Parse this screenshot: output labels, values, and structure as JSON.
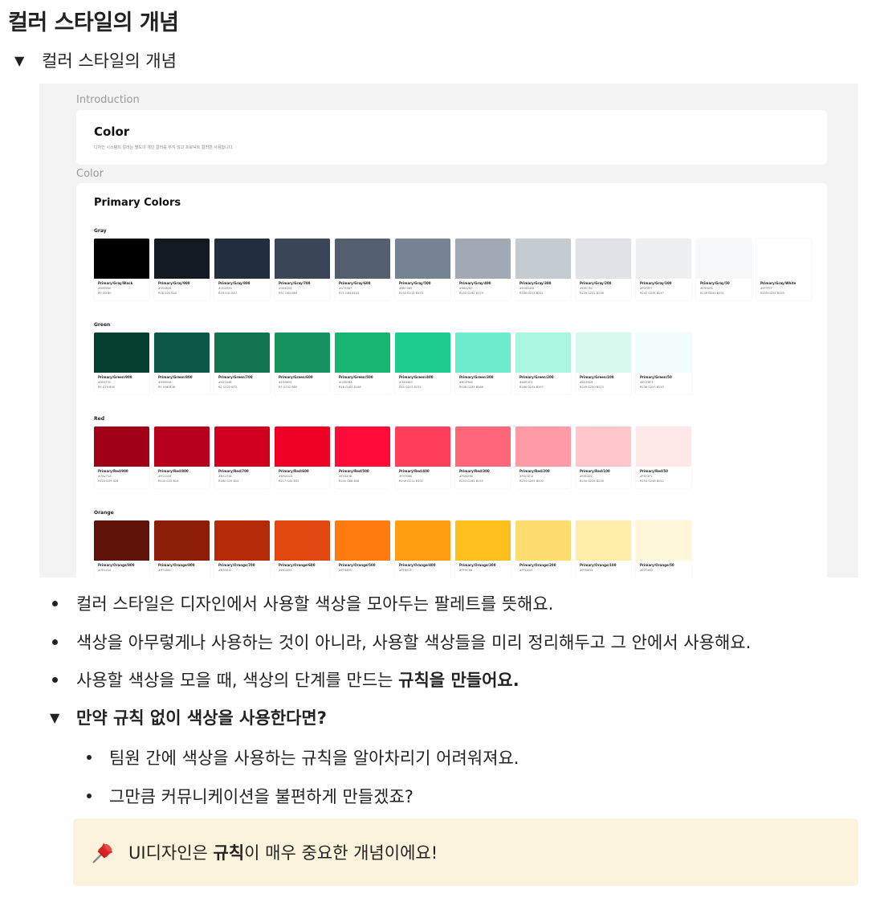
{
  "page_title": "컬러 스타일의 개념",
  "toggle": {
    "title": "컬러 스타일의 개념"
  },
  "image": {
    "intro_label": "Introduction",
    "intro_card": {
      "title": "Color",
      "desc": "디자인 시스템의 컬러는 별도의 개인 컬러를 두지 않고 프로덕트 컬러만 사용합니다."
    },
    "color_label": "Color",
    "primary_title": "Primary Colors",
    "groups": [
      {
        "label": "Gray",
        "swatches": [
          {
            "name": "Primary/Gray/Black",
            "hex": "#000000",
            "rgb": "R0 G0 B0",
            "color": "#000000"
          },
          {
            "name": "Primary/Gray/900",
            "hex": "#101828",
            "rgb": "R16 G24 B40",
            "color": "#131a22"
          },
          {
            "name": "Primary/Gray/800",
            "hex": "#1D2939",
            "rgb": "R29 G41 B57",
            "color": "#222e3e"
          },
          {
            "name": "Primary/Gray/700",
            "hex": "#344054",
            "rgb": "R52 G64 B84",
            "color": "#3a4556"
          },
          {
            "name": "Primary/Gray/600",
            "hex": "#475467",
            "rgb": "R71 G84 B103",
            "color": "#545f6d"
          },
          {
            "name": "Primary/Gray/500",
            "hex": "#667085",
            "rgb": "R102 G112 B133",
            "color": "#758392"
          },
          {
            "name": "Primary/Gray/400",
            "hex": "#98A2B3",
            "rgb": "R152 G162 B179",
            "color": "#a0a9b4"
          },
          {
            "name": "Primary/Gray/300",
            "hex": "#D0D5DD",
            "rgb": "R208 G213 B221",
            "color": "#c5ccd1"
          },
          {
            "name": "Primary/Gray/200",
            "hex": "#E4E7EC",
            "rgb": "R228 G231 B236",
            "color": "#dfe2e6"
          },
          {
            "name": "Primary/Gray/100",
            "hex": "#F2F4F7",
            "rgb": "R242 G244 B247",
            "color": "#eceef0"
          },
          {
            "name": "Primary/Gray/50",
            "hex": "#F9FAFB",
            "rgb": "R249 G250 B251",
            "color": "#f7f8fa"
          },
          {
            "name": "Primary/Gray/White",
            "hex": "#FFFFFF",
            "rgb": "R255 G255 B255",
            "color": "#ffffff"
          }
        ]
      },
      {
        "label": "Green",
        "swatches": [
          {
            "name": "Primary/Green/900",
            "hex": "#054F31",
            "rgb": "R5 G79 B49",
            "color": "#053f2f"
          },
          {
            "name": "Primary/Green/800",
            "hex": "#05603A",
            "rgb": "R5 G96 B58",
            "color": "#0c5746"
          },
          {
            "name": "Primary/Green/700",
            "hex": "#027A48",
            "rgb": "R2 G122 B72",
            "color": "#127350"
          },
          {
            "name": "Primary/Green/600",
            "hex": "#039855",
            "rgb": "R3 G152 B85",
            "color": "#169260"
          },
          {
            "name": "Primary/Green/500",
            "hex": "#12B76A",
            "rgb": "R18 G183 B106",
            "color": "#17b46f"
          },
          {
            "name": "Primary/Green/400",
            "hex": "#32D583",
            "rgb": "R50 G213 B131",
            "color": "#1dcc8c"
          },
          {
            "name": "Primary/Green/300",
            "hex": "#6CE9A6",
            "rgb": "R108 G233 B166",
            "color": "#6deccb"
          },
          {
            "name": "Primary/Green/200",
            "hex": "#A6F4C5",
            "rgb": "R166 G244 B197",
            "color": "#a9f5dd"
          },
          {
            "name": "Primary/Green/100",
            "hex": "#D1FADF",
            "rgb": "R209 G250 B223",
            "color": "#d6faed"
          },
          {
            "name": "Primary/Green/50",
            "hex": "#ECFDF3",
            "rgb": "R236 G253 B243",
            "color": "#f0fdfa"
          }
        ]
      },
      {
        "label": "Red",
        "swatches": [
          {
            "name": "Primary/Red/900",
            "hex": "#7A271A",
            "rgb": "R122 G39 B26",
            "color": "#a10018"
          },
          {
            "name": "Primary/Red/800",
            "hex": "#912018",
            "rgb": "R145 G32 B24",
            "color": "#b8001d"
          },
          {
            "name": "Primary/Red/700",
            "hex": "#B42318",
            "rgb": "R180 G35 B24",
            "color": "#d10020"
          },
          {
            "name": "Primary/Red/600",
            "hex": "#D92D20",
            "rgb": "R217 G45 B32",
            "color": "#ee0024"
          },
          {
            "name": "Primary/Red/500",
            "hex": "#F04438",
            "rgb": "R240 G68 B56",
            "color": "#ff0b3a"
          },
          {
            "name": "Primary/Red/400",
            "hex": "#F97066",
            "rgb": "R249 G112 B102",
            "color": "#ff3e5c"
          },
          {
            "name": "Primary/Red/300",
            "hex": "#FDA29B",
            "rgb": "R253 G162 B155",
            "color": "#ff6678"
          },
          {
            "name": "Primary/Red/200",
            "hex": "#FECDCA",
            "rgb": "R254 G205 B202",
            "color": "#ff9aa6"
          },
          {
            "name": "Primary/Red/100",
            "hex": "#FEE4E2",
            "rgb": "R254 G228 B226",
            "color": "#ffc6cb"
          },
          {
            "name": "Primary/Red/50",
            "hex": "#FEF3F2",
            "rgb": "R254 G243 B242",
            "color": "#ffe8e8"
          }
        ]
      },
      {
        "label": "Orange",
        "swatches": [
          {
            "name": "Primary/Orange/900",
            "hex": "#7E2410",
            "rgb": "",
            "color": "#5f1308"
          },
          {
            "name": "Primary/Orange/800",
            "hex": "#97180C",
            "rgb": "",
            "color": "#8c1e07"
          },
          {
            "name": "Primary/Orange/700",
            "hex": "#B93815",
            "rgb": "",
            "color": "#b32b07"
          },
          {
            "name": "Primary/Orange/600",
            "hex": "#E62E05",
            "rgb": "",
            "color": "#e04710"
          },
          {
            "name": "Primary/Orange/500",
            "hex": "#FF4405",
            "rgb": "",
            "color": "#ff7a0f"
          },
          {
            "name": "Primary/Orange/400",
            "hex": "#FF692E",
            "rgb": "",
            "color": "#ff9e10"
          },
          {
            "name": "Primary/Orange/300",
            "hex": "#FF9C66",
            "rgb": "",
            "color": "#ffbf1d"
          },
          {
            "name": "Primary/Orange/200",
            "hex": "#FFC4A3",
            "rgb": "",
            "color": "#ffdc6e"
          },
          {
            "name": "Primary/Orange/100",
            "hex": "#FFE6D5",
            "rgb": "",
            "color": "#ffedaa"
          },
          {
            "name": "Primary/Orange/50",
            "hex": "#FFF4ED",
            "rgb": "",
            "color": "#fff7d8"
          }
        ]
      }
    ]
  },
  "bullets": [
    {
      "text": "컬러 스타일은 디자인에서 사용할 색상을 모아두는 팔레트를 뜻해요."
    },
    {
      "text": "색상을 아무렇게나 사용하는 것이 아니라, 사용할 색상들을 미리 정리해두고 그 안에서 사용해요."
    },
    {
      "text": "사용할 색상을 모을 때, 색상의 단계를 만드는 ",
      "bold": "규칙을 만들어요."
    }
  ],
  "sub_toggle": {
    "title": "만약 규칙 없이 색상을 사용한다면?",
    "items": [
      "팀원 간에 색상을 사용하는 규칙을 알아차리기 어려워져요.",
      "그만큼 커뮤니케이션을 불편하게 만들겠죠?"
    ]
  },
  "callout": {
    "icon": "pushpin-icon",
    "before": "UI디자인은 ",
    "bold": "규칙",
    "after": "이 매우 중요한 개념이에요!"
  }
}
